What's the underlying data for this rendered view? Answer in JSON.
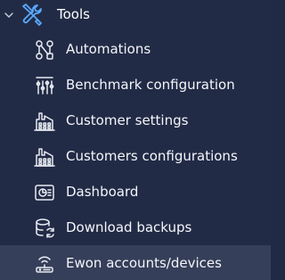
{
  "tree": {
    "parent": {
      "label": "Tools",
      "expanded": true,
      "icon": "tools-wrench-screwdriver-icon",
      "icon_color": "#5aa9ff"
    },
    "items": [
      {
        "label": "Automations",
        "icon": "automation-nodes-icon"
      },
      {
        "label": "Benchmark configuration",
        "icon": "benchmark-sliders-icon"
      },
      {
        "label": "Customer settings",
        "icon": "factory-icon"
      },
      {
        "label": "Customers configurations",
        "icon": "factory-icon"
      },
      {
        "label": "Dashboard",
        "icon": "dashboard-monitor-icon"
      },
      {
        "label": "Download backups",
        "icon": "database-sync-icon"
      },
      {
        "label": "Ewon accounts/devices",
        "icon": "router-wifi-icon",
        "active": true
      }
    ]
  },
  "colors": {
    "background": "#222b46",
    "active_row": "#363f59",
    "text": "#f4f6fa",
    "icon": "#e8ebf2"
  }
}
